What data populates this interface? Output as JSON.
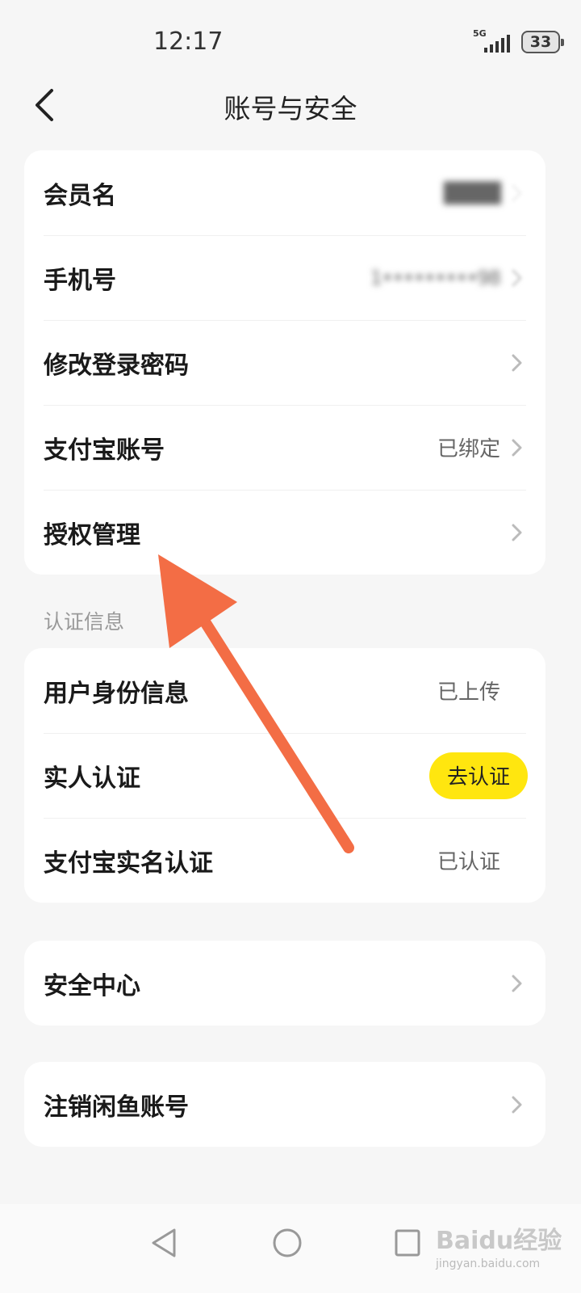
{
  "status": {
    "time": "12:17",
    "network": "5G",
    "battery": "33"
  },
  "header": {
    "title": "账号与安全"
  },
  "account": {
    "rows": [
      {
        "label": "会员名",
        "value": "████",
        "blurred": true
      },
      {
        "label": "手机号",
        "value": "1•••••••••98",
        "blurred": true
      },
      {
        "label": "修改登录密码",
        "value": ""
      },
      {
        "label": "支付宝账号",
        "value": "已绑定"
      },
      {
        "label": "授权管理",
        "value": ""
      }
    ]
  },
  "verification": {
    "section_label": "认证信息",
    "rows": [
      {
        "label": "用户身份信息",
        "value": "已上传"
      },
      {
        "label": "实人认证",
        "action": "去认证"
      },
      {
        "label": "支付宝实名认证",
        "value": "已认证"
      }
    ]
  },
  "security_center": {
    "label": "安全中心"
  },
  "cancel_account": {
    "label": "注销闲鱼账号"
  },
  "watermark": {
    "text": "Baidu经验",
    "sub": "jingyan.baidu.com"
  },
  "colors": {
    "accent": "#ffe60f",
    "arrow": "#f36d45",
    "background": "#f6f6f6"
  }
}
